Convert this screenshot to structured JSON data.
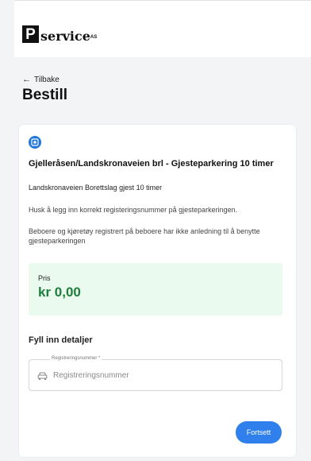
{
  "header": {
    "logo_letter": "P",
    "logo_word": "service",
    "logo_suffix": "AS"
  },
  "nav": {
    "back_label": "Tilbake"
  },
  "page": {
    "title": "Bestill"
  },
  "product": {
    "icon": "parking-icon",
    "title": "Gjelleråsen/Landskronaveien brl - Gjesteparkering 10 timer",
    "subtitle": "Landskronaveien Borettslag gjest 10 timer",
    "note_registration": "Husk å legg inn korrekt registeringsnummer på gjesteparkeringen.",
    "note_residents": "Beboere og kjøretøy registrert på beboere har ikke anledning til å benytte gjesteparkeringen"
  },
  "price": {
    "label": "Pris",
    "value": "kr 0,00"
  },
  "details": {
    "heading": "Fyll inn detaljer",
    "registration_field": {
      "legend": "Registreringsnummer *",
      "placeholder": "Registreringsnummer",
      "value": "",
      "icon": "car-icon"
    }
  },
  "actions": {
    "continue_label": "Fortsett"
  },
  "colors": {
    "accent": "#2f80ed",
    "price_bg": "#eafaef",
    "price_text": "#1e7e3a"
  }
}
